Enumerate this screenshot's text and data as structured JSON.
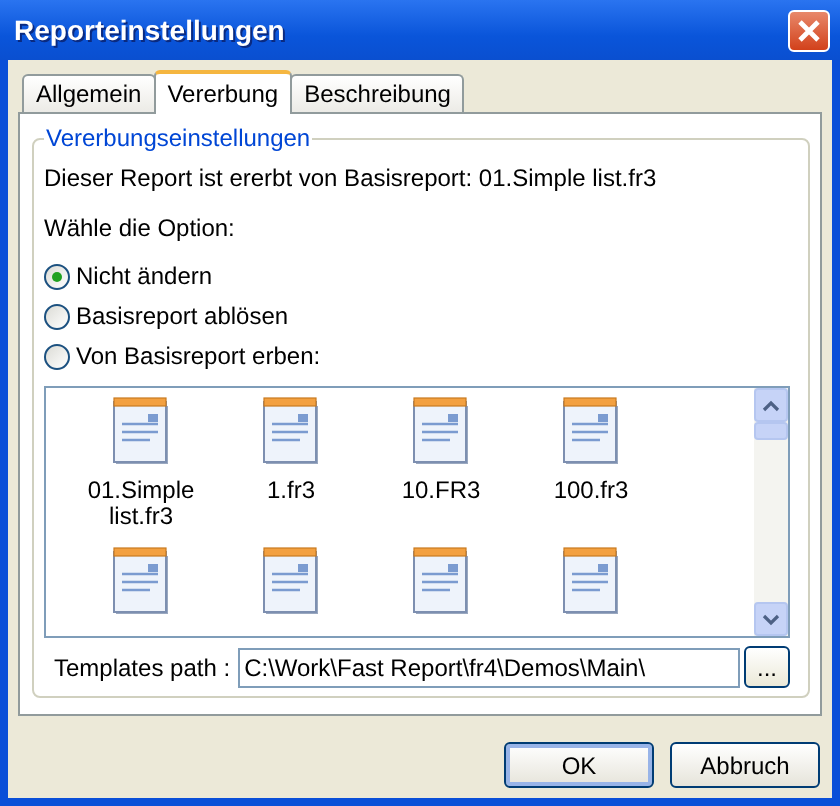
{
  "window": {
    "title": "Reporteinstellungen"
  },
  "tabs": [
    {
      "label": "Allgemein",
      "selected": false
    },
    {
      "label": "Vererbung",
      "selected": true
    },
    {
      "label": "Beschreibung",
      "selected": false
    }
  ],
  "group": {
    "title": "Vererbungseinstellungen",
    "info": "Dieser Report ist ererbt von Basisreport: 01.Simple list.fr3",
    "prompt": "Wähle die Option:"
  },
  "options": [
    {
      "label": "Nicht ändern",
      "selected": true
    },
    {
      "label": "Basisreport ablösen",
      "selected": false
    },
    {
      "label": "Von Basisreport erben:",
      "selected": false
    }
  ],
  "templates": [
    {
      "kind": "file",
      "name": "01.Simple list.fr3"
    },
    {
      "kind": "file",
      "name": "1.fr3"
    },
    {
      "kind": "file",
      "name": "10.FR3"
    },
    {
      "kind": "file",
      "name": "100.fr3"
    },
    {
      "kind": "file"
    },
    {
      "kind": "file"
    },
    {
      "kind": "file"
    },
    {
      "kind": "file"
    }
  ],
  "path": {
    "label": "Templates path :",
    "value": "C:\\Work\\Fast Report\\fr4\\Demos\\Main\\",
    "browse": "..."
  },
  "buttons": [
    "OK",
    "Abbruch"
  ]
}
